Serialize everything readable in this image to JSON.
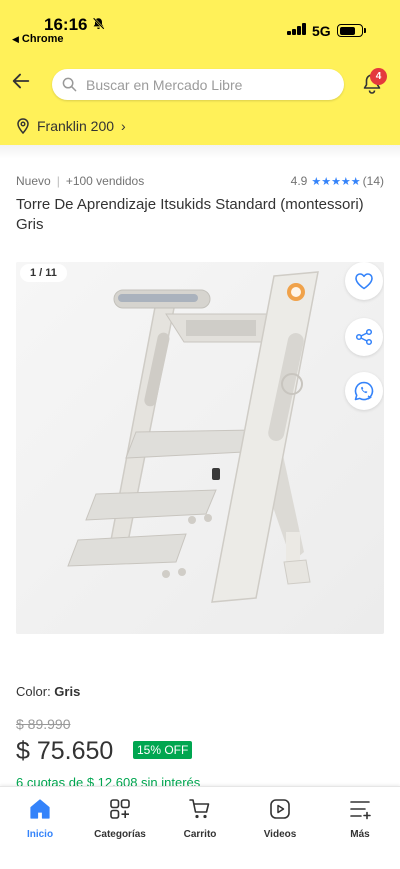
{
  "status": {
    "time": "16:16",
    "back_app": "Chrome",
    "network": "5G"
  },
  "header": {
    "search_placeholder": "Buscar en Mercado Libre",
    "notification_count": "4",
    "location": "Franklin 200"
  },
  "product": {
    "condition": "Nuevo",
    "sold": "+100 vendidos",
    "rating": "4.9",
    "reviews": "(14)",
    "title": "Torre De Aprendizaje Itsukids Standard (montessori) Gris",
    "image_counter": "1 / 11",
    "color_label": "Color: ",
    "color_value": "Gris",
    "old_price": "$ 89.990",
    "price": "$ 75.650",
    "discount": "15% OFF",
    "installments": "6 cuotas de $ 12.608 sin interés"
  },
  "nav": {
    "items": [
      {
        "label": "Inicio",
        "icon": "home-icon",
        "active": true
      },
      {
        "label": "Categorías",
        "icon": "categories-icon"
      },
      {
        "label": "Carrito",
        "icon": "cart-icon"
      },
      {
        "label": "Videos",
        "icon": "video-icon"
      },
      {
        "label": "Más",
        "icon": "more-icon"
      }
    ]
  },
  "colors": {
    "brand_yellow": "#fff159",
    "accent_blue": "#3483fa",
    "discount_green": "#00a650",
    "badge_red": "#e4393c"
  }
}
